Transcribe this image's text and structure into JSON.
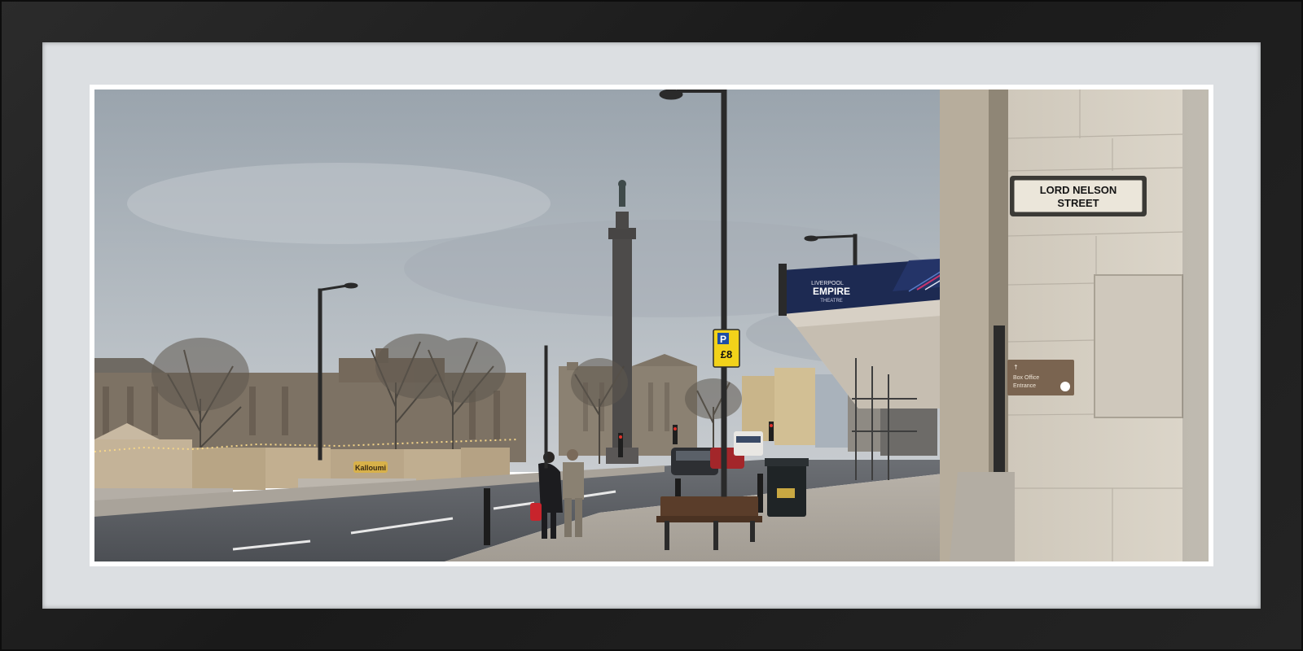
{
  "scene": {
    "street_sign": {
      "line1": "LORD NELSON",
      "line2": "STREET"
    },
    "theatre_sign": {
      "top": "LIVERPOOL",
      "name": "EMPIRE",
      "bottom": "THEATRE"
    },
    "parking_sign": {
      "letter": "P",
      "price": "£8"
    },
    "box_office_sign": {
      "line1": "Box Office",
      "line2": "Entrance"
    },
    "market_stall_sign": "Kalloumi"
  },
  "colors": {
    "frame": "#1f1f1f",
    "mat": "#dcdfe2",
    "sky": "#aeb6bd",
    "stone": "#d8d2c6",
    "road": "#5a5d62",
    "canopy": "#1d2a52",
    "parking_sign": "#f2d21a"
  }
}
